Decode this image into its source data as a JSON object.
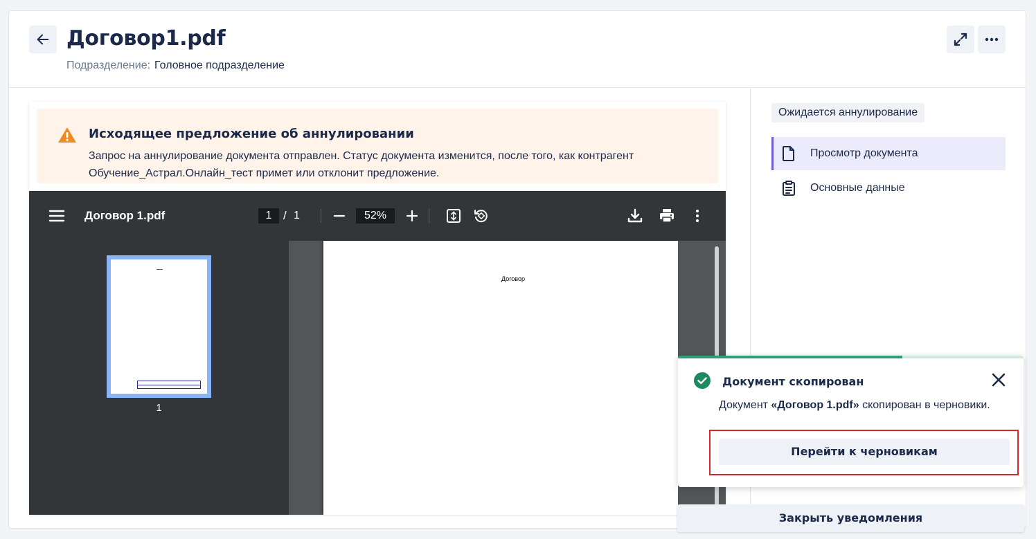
{
  "header": {
    "title": "Договор1.pdf",
    "subdivision_label": "Подразделение:",
    "subdivision_value": "Головное подразделение"
  },
  "status": {
    "badge": "Ожидается аннулирование"
  },
  "nav": [
    {
      "label": "Просмотр документа",
      "icon": "file-icon",
      "active": true
    },
    {
      "label": "Основные данные",
      "icon": "clipboard-icon",
      "active": false
    }
  ],
  "alert": {
    "title": "Исходящее предложение об аннулировании",
    "text": "Запрос на аннулирование документа отправлен. Статус документа изменится, после того, как контрагент Обучение_Астрал.Онлайн_тест примет или отклонит предложение.",
    "color": "#fff3ea",
    "icon_color": "#f08a24"
  },
  "pdf_viewer": {
    "file_name": "Договор 1.pdf",
    "current_page": "1",
    "separator": "/",
    "total_pages": "1",
    "zoom": "52%",
    "thumbnail_label": "1",
    "page_heading": "Договор"
  },
  "toast": {
    "title": "Документ скопирован",
    "text_prefix": "Документ ",
    "text_doc": "«Договор 1.pdf»",
    "text_suffix": " скопирован в черновики.",
    "action": "Перейти к черновикам",
    "progress": 0.65,
    "accent": "#2e9d7a",
    "highlight_color": "#d9262c"
  },
  "close_all": "Закрыть уведомления"
}
